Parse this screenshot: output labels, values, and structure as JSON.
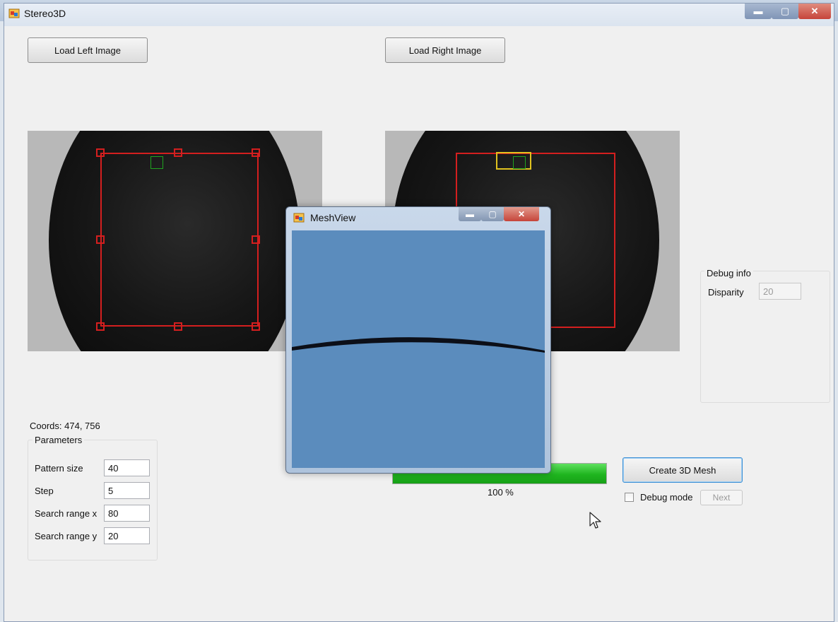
{
  "window": {
    "title": "Stereo3D",
    "caption": {
      "minimize": "▬",
      "maximize": "▢",
      "close": "✕"
    }
  },
  "buttons": {
    "load_left": "Load Left Image",
    "load_right": "Load Right Image",
    "create_mesh": "Create 3D Mesh",
    "next": "Next"
  },
  "coords": "Coords: 474, 756",
  "parameters": {
    "title": "Parameters",
    "fields": [
      {
        "label": "Pattern size",
        "value": "40"
      },
      {
        "label": "Step",
        "value": "5"
      },
      {
        "label": "Search range x",
        "value": "80"
      },
      {
        "label": "Search range y",
        "value": "20"
      }
    ]
  },
  "debug": {
    "title": "Debug info",
    "disparity_label": "Disparity",
    "disparity_value": "20",
    "mode_label": "Debug mode",
    "mode_checked": false
  },
  "progress": {
    "value": 1.0,
    "text": "100 %"
  },
  "meshview": {
    "title": "MeshView",
    "background_color": "#5b8cbd"
  },
  "colors": {
    "selection": "#d41f1f",
    "pattern_match": "#1fa31f",
    "search_window": "#e0c21f",
    "progress": "#1fb51f"
  },
  "icons": [
    "app-icon",
    "minimize-icon",
    "maximize-icon",
    "close-icon",
    "checkbox-icon",
    "mouse-pointer-icon"
  ]
}
